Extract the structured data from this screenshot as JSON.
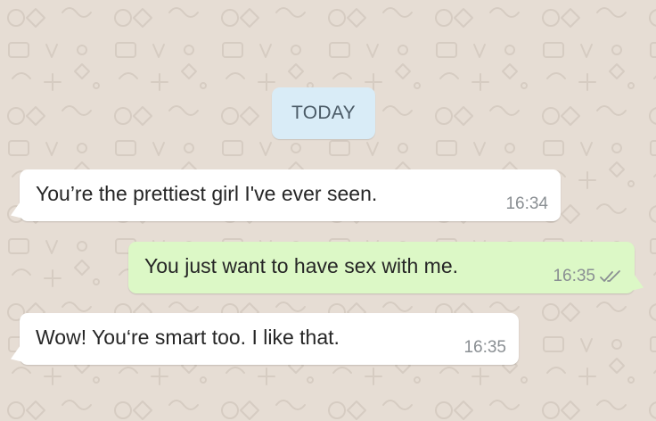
{
  "date_divider": {
    "label": "TODAY"
  },
  "messages": [
    {
      "direction": "incoming",
      "text": "You’re the prettiest girl I've ever seen.",
      "time": "16:34"
    },
    {
      "direction": "outgoing",
      "text": "You just want to have sex with me.",
      "time": "16:35",
      "status": "read-double-check-icon"
    },
    {
      "direction": "incoming",
      "text": "Wow! You‘re smart too. I like that.",
      "time": "16:35"
    }
  ],
  "colors": {
    "wallpaper": "#e6ddd4",
    "incoming_bubble": "#ffffff",
    "outgoing_bubble": "#dcf8c6",
    "date_chip": "#d9ecf7"
  }
}
